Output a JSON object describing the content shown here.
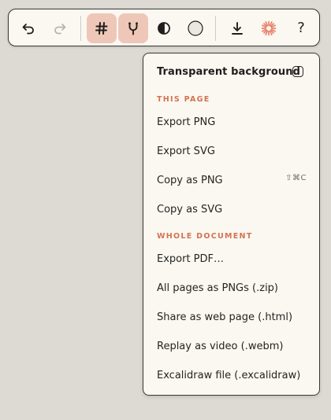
{
  "toolbar": {
    "icons": [
      "undo-icon",
      "redo-icon",
      "grid-icon",
      "branch-icon",
      "contrast-icon",
      "circle-icon",
      "download-icon",
      "sparkle-icon",
      "help-icon"
    ],
    "help_label": "?",
    "accent_color": "#eec7b8",
    "sparkle_color": "#e8836a"
  },
  "export_menu": {
    "transparent_label": "Transparent background",
    "transparent_checked": false,
    "this_page_header": "THIS PAGE",
    "this_page_items": [
      "Export PNG",
      "Export SVG",
      "Copy as PNG",
      "Copy as SVG"
    ],
    "copy_png_shortcut": "⇧⌘C",
    "whole_doc_header": "WHOLE DOCUMENT",
    "whole_doc_items": [
      "Export PDF…",
      "All pages as PNGs (.zip)",
      "Share as web page (.html)",
      "Replay as video (.webm)",
      "Excalidraw file (.excalidraw)"
    ],
    "section_color": "#d4734f"
  }
}
